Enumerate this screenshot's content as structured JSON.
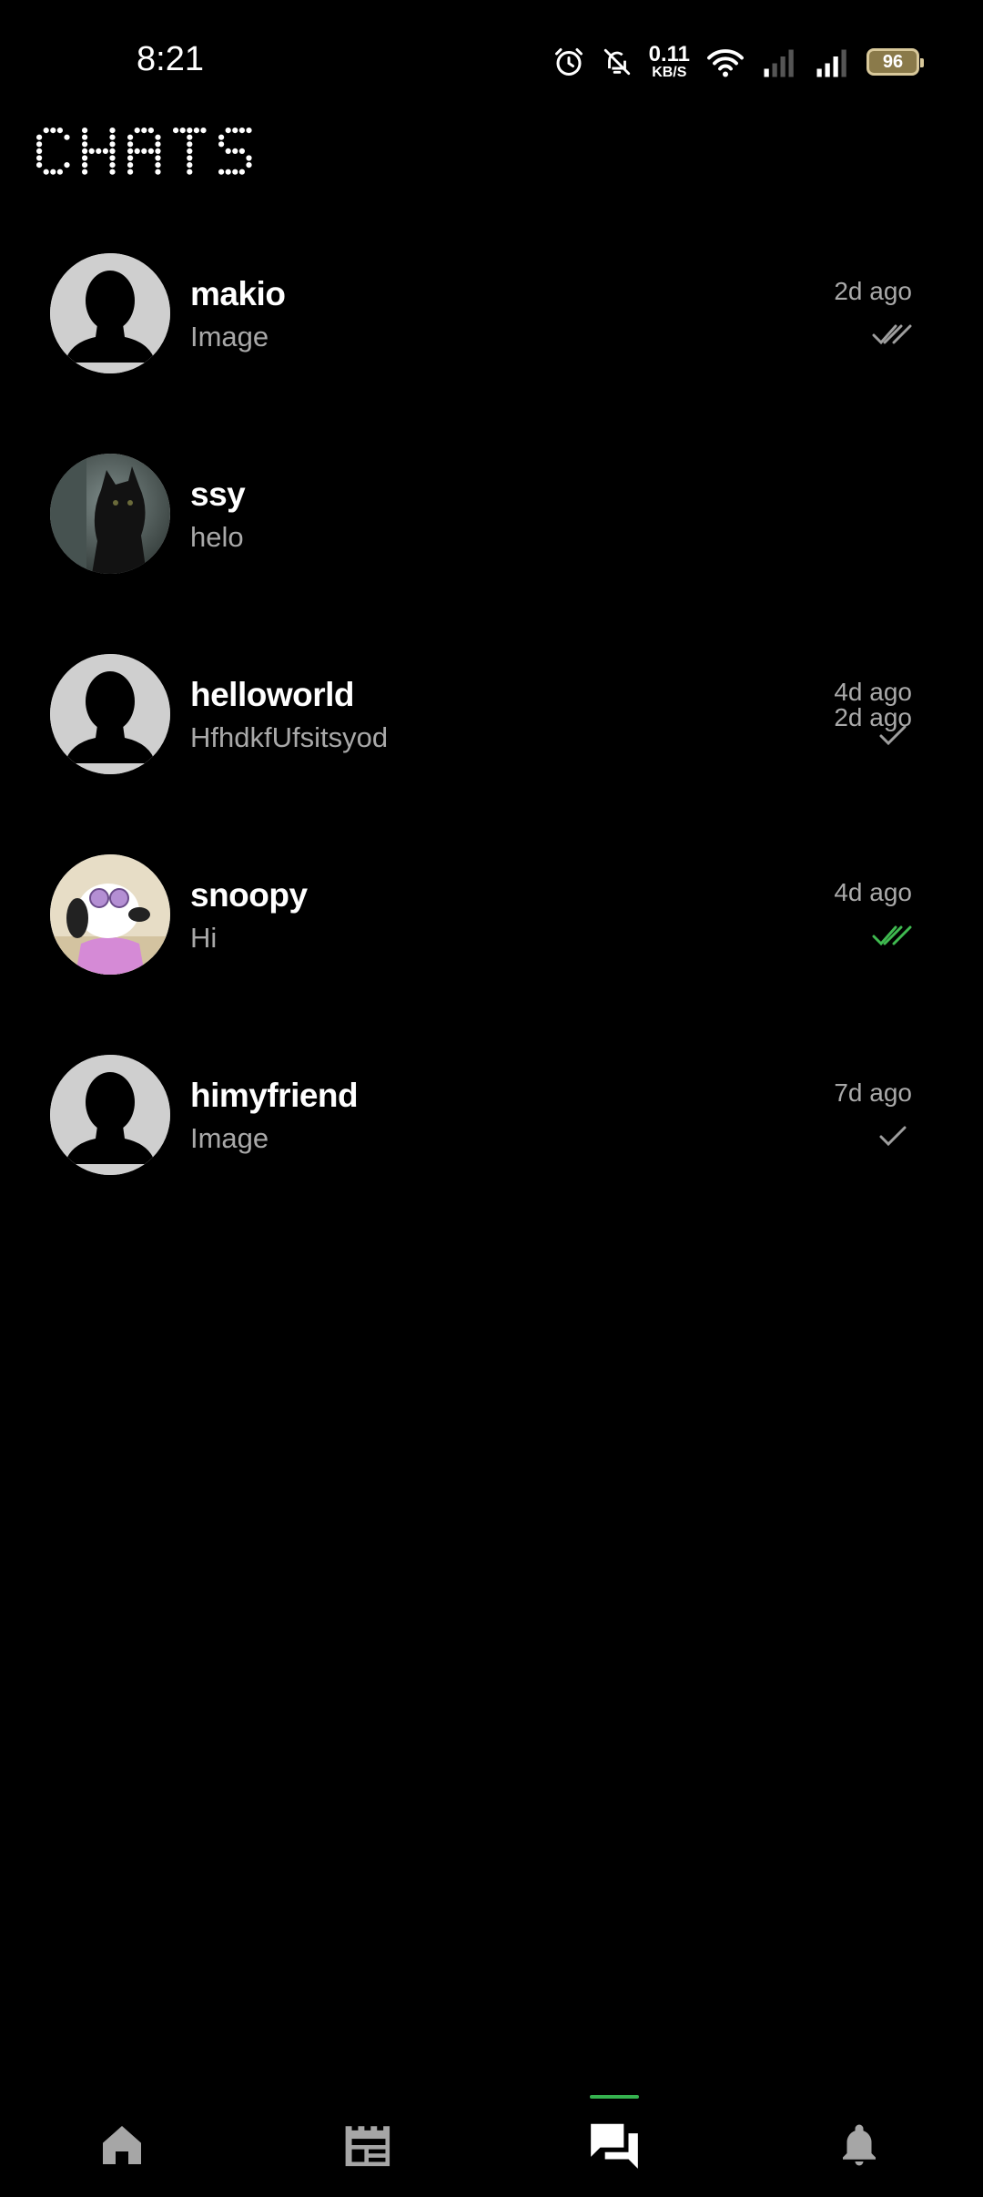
{
  "status_bar": {
    "time": "8:21",
    "net_speed_value": "0.11",
    "net_speed_unit": "KB/S",
    "battery": "96",
    "icons": [
      "alarm-icon",
      "bell-off-icon",
      "wifi-icon",
      "signal-weak-icon",
      "signal-medium-icon",
      "battery-icon"
    ]
  },
  "header": {
    "title": "CHATS"
  },
  "chats": [
    {
      "name": "makio",
      "last_message": "Image",
      "time": "2d ago",
      "status": "double-check",
      "status_color": "#9e9e9e",
      "avatar": "default-avatar"
    },
    {
      "name": "ssy",
      "last_message": "helo",
      "time": "2d ago",
      "status": "none",
      "avatar": "cat-photo-avatar"
    },
    {
      "name": "helloworld",
      "last_message": "HfhdkfUfsitsyod",
      "time": "4d ago",
      "status": "single-check",
      "status_color": "#9e9e9e",
      "avatar": "default-avatar"
    },
    {
      "name": "snoopy",
      "last_message": "Hi",
      "time": "4d ago",
      "status": "double-check",
      "status_color": "#3fb950",
      "avatar": "snoopy-photo-avatar"
    },
    {
      "name": "himyfriend",
      "last_message": "Image",
      "time": "7d ago",
      "status": "single-check",
      "status_color": "#9e9e9e",
      "avatar": "default-avatar"
    }
  ],
  "bottom_nav": {
    "items": [
      "home-icon",
      "feed-icon",
      "chats-icon",
      "notifications-icon"
    ],
    "active": "chats-icon",
    "active_color": "#35b24f"
  }
}
